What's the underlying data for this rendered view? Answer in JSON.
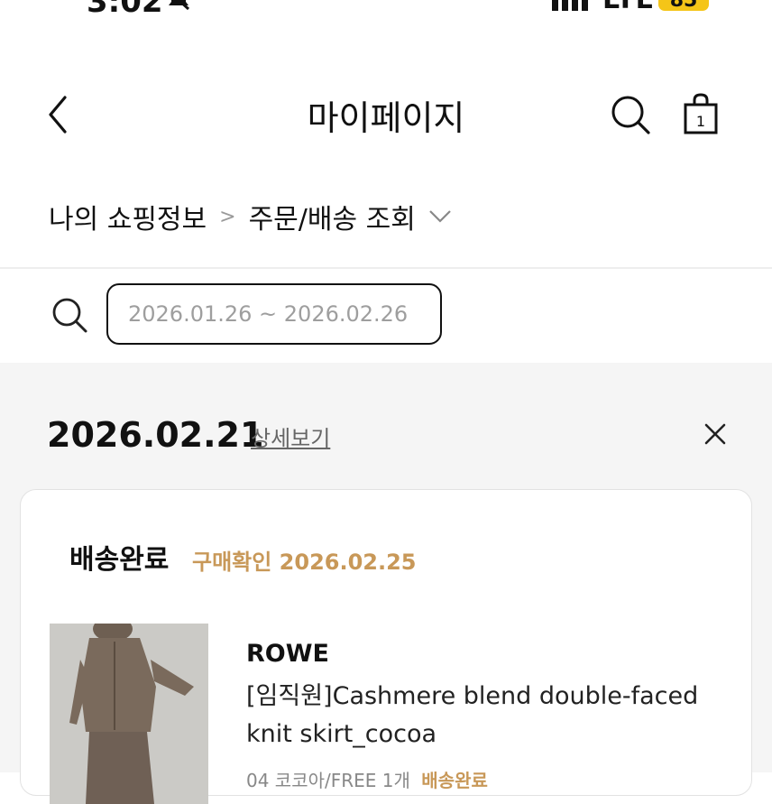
{
  "status_bar": {
    "time": "3:02",
    "network": "LTE",
    "battery": "85"
  },
  "header": {
    "title": "마이페이지",
    "cart_count": "1"
  },
  "breadcrumb": {
    "parent": "나의 쇼핑정보",
    "separator": ">",
    "current": "주문/배송 조회"
  },
  "search": {
    "date_range": "2026.01.26 ~ 2026.02.26"
  },
  "order": {
    "date": "2026.02.21",
    "detail_link": "상세보기",
    "status": "배송완료",
    "confirm_text": "구매확인 2026.02.25",
    "brand": "ROWE",
    "product_name": "[임직원]Cashmere blend double-faced knit skirt_cocoa",
    "option": "04 코코아/FREE 1개",
    "option_status": "배송완료"
  },
  "colors": {
    "accent": "#c89858",
    "text": "#111111",
    "muted": "#9e9e9e",
    "background_gray": "#f5f5f5"
  },
  "icons": [
    "bell-slash-icon",
    "signal-icon",
    "back-chevron-icon",
    "search-icon",
    "shopping-bag-icon",
    "chevron-down-icon",
    "close-icon"
  ]
}
